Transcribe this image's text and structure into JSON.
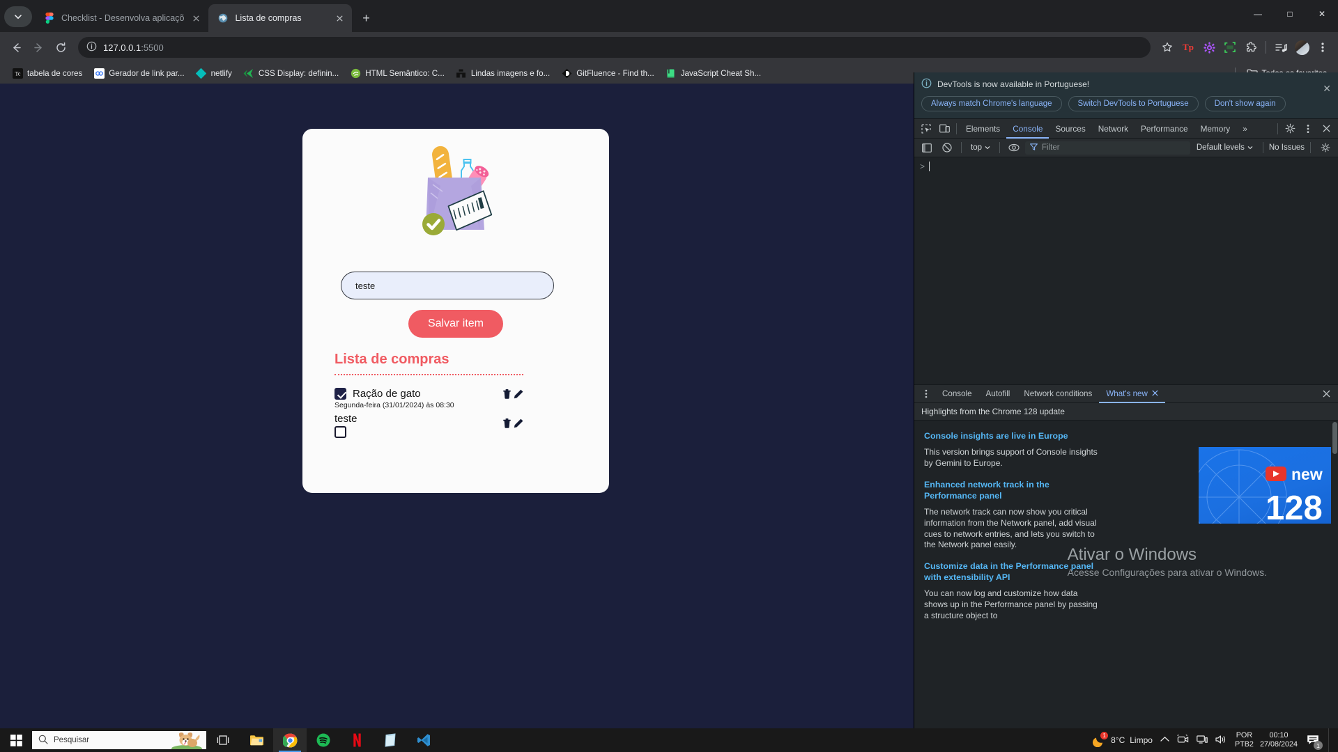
{
  "browser": {
    "tabs": [
      {
        "title": "Checklist - Desenvolva aplicaçõ",
        "favicon": "figma-icon",
        "active": false
      },
      {
        "title": "Lista de compras",
        "favicon": "globe-icon",
        "active": true
      }
    ],
    "newtab_label": "+",
    "window_controls": {
      "minimize": "—",
      "maximize": "□",
      "close": "✕"
    },
    "nav": {
      "back": "←",
      "forward": "→",
      "reload": "↻"
    },
    "omnibox": {
      "host": "127.0.0.1",
      "port": ":5500",
      "site_info_icon": "info-circle-icon",
      "bookmark_icon": "star-icon"
    },
    "toolbar_icons": [
      "star-icon",
      "tp-extension-icon",
      "gear-extension-icon",
      "screenshot-extension-icon",
      "puzzle-extensions-icon",
      "media-controls-icon",
      "profile-avatar"
    ],
    "bookmarks": [
      {
        "label": "tabela de cores",
        "icon": "tc-icon"
      },
      {
        "label": "Gerador de link par...",
        "icon": "co-icon"
      },
      {
        "label": "netlify",
        "icon": "netlify-icon"
      },
      {
        "label": "CSS Display: definin...",
        "icon": "css-tricks-icon"
      },
      {
        "label": "HTML Semântico: C...",
        "icon": "green-circle-icon"
      },
      {
        "label": "Lindas imagens e fo...",
        "icon": "unsplash-icon"
      },
      {
        "label": "GitFluence - Find th...",
        "icon": "gitfluence-icon"
      },
      {
        "label": "JavaScript Cheat Sh...",
        "icon": "js-book-icon"
      }
    ],
    "bookmarks_overflow": {
      "label": "Todos os favoritos",
      "icon": "folder-icon"
    }
  },
  "page": {
    "illustration": "grocery-bag-illustration",
    "input": {
      "value": "teste",
      "placeholder": ""
    },
    "save_button": "Salvar item",
    "list_title": "Lista de compras",
    "items": [
      {
        "name": "Ração de gato",
        "date": "Segunda-feira (31/01/2024) às 08:30",
        "checked": true
      },
      {
        "name": "teste",
        "date": "",
        "checked": false
      }
    ],
    "item_actions": {
      "delete": "trash-icon",
      "edit": "pencil-icon"
    }
  },
  "devtools": {
    "banner": {
      "message": "DevTools is now available in Portuguese!",
      "buttons": [
        "Always match Chrome's language",
        "Switch DevTools to Portuguese",
        "Don't show again"
      ],
      "close": "✕"
    },
    "panel_tabs": [
      "Elements",
      "Console",
      "Sources",
      "Network",
      "Performance",
      "Memory"
    ],
    "active_panel_tab": "Console",
    "panel_overflow": "»",
    "panel_icons": [
      "inspect-icon",
      "device-toolbar-icon",
      "settings-gear-icon",
      "more-options-icon",
      "close-devtools-icon"
    ],
    "toolbar": {
      "sidebar_icon": "console-sidebar-icon",
      "clear_icon": "clear-console-icon",
      "context": "top",
      "eye_icon": "live-expression-icon",
      "filter_placeholder": "Filter",
      "levels": "Default levels",
      "issues": "No Issues",
      "settings_icon": "console-settings-icon"
    },
    "console_prompt": ">",
    "drawer": {
      "tabs": [
        "Console",
        "Autofill",
        "Network conditions",
        "What's new"
      ],
      "active_tab": "What's new",
      "more_icon": "drawer-more-icon",
      "close": "✕",
      "subtitle": "Highlights from the Chrome 128 update",
      "articles": [
        {
          "heading": "Console insights are live in Europe",
          "body": "This version brings support of Console insights by Gemini to Europe."
        },
        {
          "heading": "Enhanced network track in the Performance panel",
          "body": "The network track can now show you critical information from the Network panel, add visual cues to network entries, and lets you switch to the Network panel easily."
        },
        {
          "heading": "Customize data in the Performance panel with extensibility API",
          "body": "You can now log and customize how data shows up in the Performance panel by passing a structure object to"
        }
      ],
      "thumbnail": {
        "label": "new",
        "version": "128",
        "play_icon": "youtube-play-icon"
      }
    }
  },
  "watermark": {
    "line1": "Ativar o Windows",
    "line2": "Acesse Configurações para ativar o Windows."
  },
  "taskbar": {
    "start_icon": "windows-start-icon",
    "search_placeholder": "Pesquisar",
    "search_icon": "search-icon",
    "task_view_icon": "task-view-icon",
    "apps": [
      "file-explorer-icon",
      "chrome-icon",
      "spotify-icon",
      "netflix-icon",
      "store-icon",
      "vscode-icon"
    ],
    "chevron_icon": "show-hidden-icons-chevron",
    "tray_icons": [
      "meet-camera-icon",
      "network-icon",
      "volume-icon"
    ],
    "weather": {
      "temp": "8°C",
      "condition": "Limpo",
      "icon": "moon-icon",
      "badge": "1"
    },
    "language": {
      "line1": "POR",
      "line2": "PTB2"
    },
    "clock": {
      "time": "00:10",
      "date": "27/08/2024"
    },
    "notifications": {
      "icon": "notification-icon",
      "count": "1"
    }
  },
  "colors": {
    "accent_red": "#f05b62",
    "page_bg": "#1b1f3b",
    "devtools_link": "#8ab4f8"
  }
}
